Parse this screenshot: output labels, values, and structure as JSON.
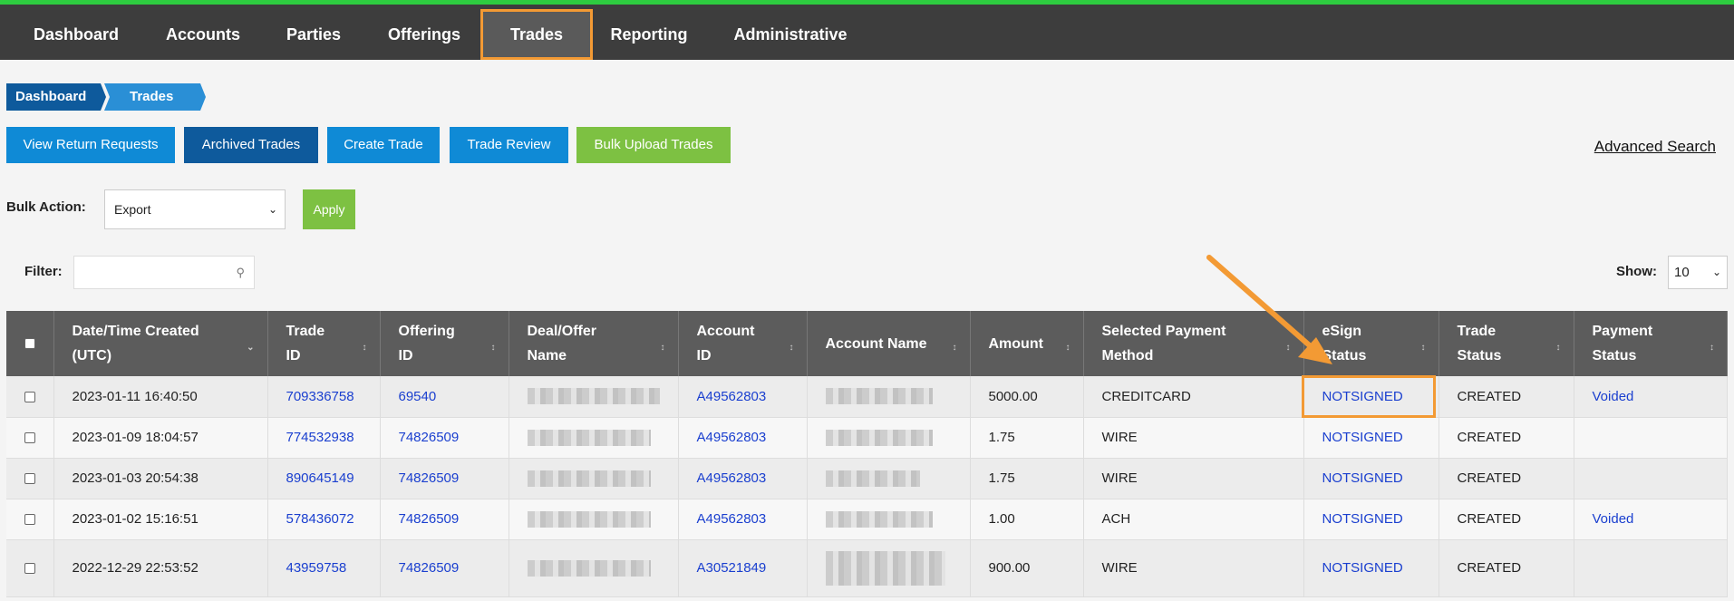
{
  "nav": {
    "items": [
      {
        "label": "Dashboard"
      },
      {
        "label": "Accounts"
      },
      {
        "label": "Parties"
      },
      {
        "label": "Offerings"
      },
      {
        "label": "Trades"
      },
      {
        "label": "Reporting"
      },
      {
        "label": "Administrative"
      }
    ],
    "active": "Trades"
  },
  "breadcrumb": [
    "Dashboard",
    "Trades"
  ],
  "actions": {
    "view_return": "View Return Requests",
    "archived": "Archived Trades",
    "create": "Create Trade",
    "review": "Trade Review",
    "bulk_upload": "Bulk Upload Trades",
    "advanced_search": "Advanced Search"
  },
  "bulk": {
    "label": "Bulk Action:",
    "value": "Export",
    "apply": "Apply"
  },
  "filter": {
    "label": "Filter:",
    "value": ""
  },
  "show": {
    "label": "Show:",
    "value": "10"
  },
  "colors": {
    "accent_dark": "#0e5a9c",
    "accent": "#0f8ad6",
    "green": "#7dc142",
    "highlight": "#f39a34"
  },
  "table": {
    "headers": [
      {
        "l1": "Date/Time Created",
        "l2": "(UTC)"
      },
      {
        "l1": "Trade",
        "l2": "ID"
      },
      {
        "l1": "Offering",
        "l2": "ID"
      },
      {
        "l1": "Deal/Offer",
        "l2": "Name"
      },
      {
        "l1": "Account",
        "l2": "ID"
      },
      {
        "l1": "Account Name",
        "l2": ""
      },
      {
        "l1": "Amount",
        "l2": ""
      },
      {
        "l1": "Selected Payment",
        "l2": "Method"
      },
      {
        "l1": "eSign",
        "l2": "Status"
      },
      {
        "l1": "Trade",
        "l2": "Status"
      },
      {
        "l1": "Payment",
        "l2": "Status"
      }
    ],
    "rows": [
      {
        "created": "2023-01-11 16:40:50",
        "trade_id": "709336758",
        "offering_id": "69540",
        "account_id": "A49562803",
        "amount": "5000.00",
        "method": "CREDITCARD",
        "esign": "NOTSIGNED",
        "trade_status": "CREATED",
        "payment_status": "Voided"
      },
      {
        "created": "2023-01-09 18:04:57",
        "trade_id": "774532938",
        "offering_id": "74826509",
        "account_id": "A49562803",
        "amount": "1.75",
        "method": "WIRE",
        "esign": "NOTSIGNED",
        "trade_status": "CREATED",
        "payment_status": ""
      },
      {
        "created": "2023-01-03 20:54:38",
        "trade_id": "890645149",
        "offering_id": "74826509",
        "account_id": "A49562803",
        "amount": "1.75",
        "method": "WIRE",
        "esign": "NOTSIGNED",
        "trade_status": "CREATED",
        "payment_status": ""
      },
      {
        "created": "2023-01-02 15:16:51",
        "trade_id": "578436072",
        "offering_id": "74826509",
        "account_id": "A49562803",
        "amount": "1.00",
        "method": "ACH",
        "esign": "NOTSIGNED",
        "trade_status": "CREATED",
        "payment_status": "Voided"
      },
      {
        "created": "2022-12-29 22:53:52",
        "trade_id": "43959758",
        "offering_id": "74826509",
        "account_id": "A30521849",
        "amount": "900.00",
        "method": "WIRE",
        "esign": "NOTSIGNED",
        "trade_status": "CREATED",
        "payment_status": ""
      }
    ]
  }
}
